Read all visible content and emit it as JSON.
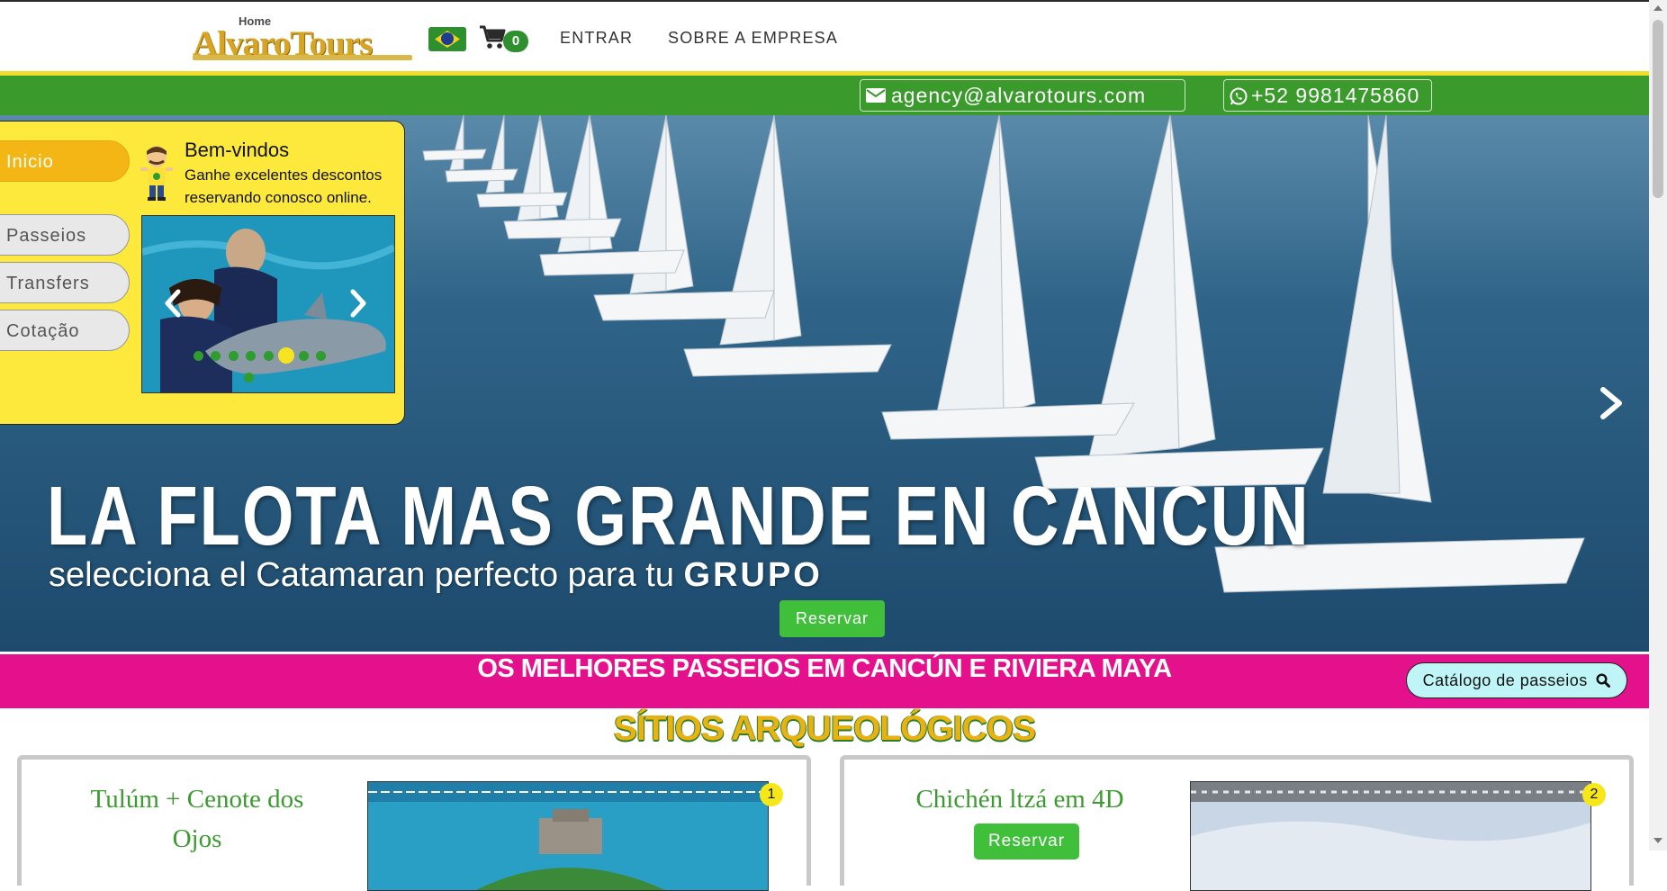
{
  "header": {
    "logo_home": "Home",
    "logo_text": "AlvaroTours",
    "cart_count": "0",
    "nav": [
      "ENTRAR",
      "SOBRE A EMPRESA"
    ]
  },
  "contact": {
    "email": "agency@alvarotours.com",
    "phone": "+52 9981475860"
  },
  "hero": {
    "title": "LA FLOTA MAS GRANDE EN CANCUN",
    "subtitle_prefix": "selecciona el Catamaran perfecto para tu ",
    "subtitle_bold": "GRUPO",
    "reserve_label": "Reservar"
  },
  "panel": {
    "tabs": [
      "Inicio",
      "Passeios",
      "Transfers",
      "Cotação"
    ],
    "welcome_title": "Bem-vindos",
    "welcome_text": "Ganhe excelentes descontos reservando conosco online.",
    "slider_dots": 9,
    "slider_active_index": 5
  },
  "banner": {
    "title": "OS MELHORES PASSEIOS EM CANCÚN E RIVIERA MAYA",
    "catalog_label": "Catálogo de passeios"
  },
  "section": {
    "title": "SÍTIOS ARQUEOLÓGICOS"
  },
  "cards": [
    {
      "title_line1": "Tulúm + Cenote dos",
      "title_line2": "Ojos",
      "number": "1"
    },
    {
      "title": "Chichén ltzá em 4D",
      "reserve_label": "Reservar",
      "number": "2"
    }
  ],
  "colors": {
    "green": "#3a9a2c",
    "yellow": "#fde93c",
    "pink": "#e5108c",
    "gold": "#e8b213"
  }
}
